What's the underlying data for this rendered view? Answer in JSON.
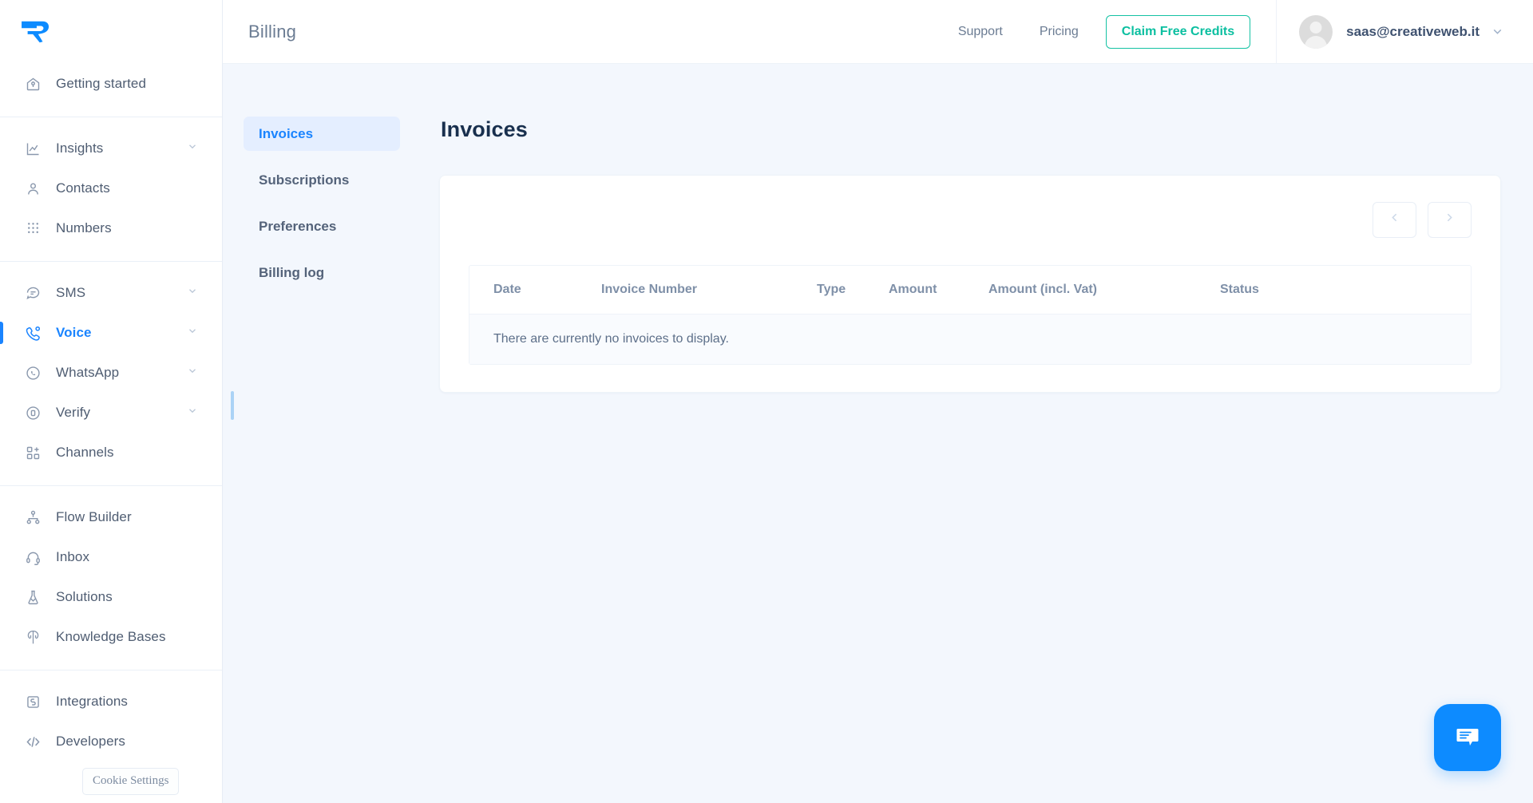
{
  "brand": {
    "logo_name": "messagebird-logo",
    "accent_blue": "#1a84ff",
    "accent_teal": "#0bbfa0",
    "page_bg": "#f3f7fd"
  },
  "sidebar": {
    "groups": [
      {
        "items": [
          {
            "label": "Getting started",
            "icon": "home-rocket-icon",
            "active": false,
            "expandable": false
          }
        ]
      },
      {
        "items": [
          {
            "label": "Insights",
            "icon": "chart-line-icon",
            "active": false,
            "expandable": true
          },
          {
            "label": "Contacts",
            "icon": "person-icon",
            "active": false,
            "expandable": false
          },
          {
            "label": "Numbers",
            "icon": "dialpad-icon",
            "active": false,
            "expandable": false
          }
        ]
      },
      {
        "items": [
          {
            "label": "SMS",
            "icon": "speech-bubble-icon",
            "active": false,
            "expandable": true
          },
          {
            "label": "Voice",
            "icon": "phone-icon",
            "active": true,
            "expandable": true
          },
          {
            "label": "WhatsApp",
            "icon": "whatsapp-icon",
            "active": false,
            "expandable": true
          },
          {
            "label": "Verify",
            "icon": "verify-shield-icon",
            "active": false,
            "expandable": true
          },
          {
            "label": "Channels",
            "icon": "channels-grid-icon",
            "active": false,
            "expandable": false
          }
        ]
      },
      {
        "items": [
          {
            "label": "Flow Builder",
            "icon": "flow-nodes-icon",
            "active": false,
            "expandable": false
          },
          {
            "label": "Inbox",
            "icon": "headset-icon",
            "active": false,
            "expandable": false
          },
          {
            "label": "Solutions",
            "icon": "flask-icon",
            "active": false,
            "expandable": false
          },
          {
            "label": "Knowledge Bases",
            "icon": "knowledge-tree-icon",
            "active": false,
            "expandable": false
          }
        ]
      },
      {
        "items": [
          {
            "label": "Integrations",
            "icon": "integrations-icon",
            "active": false,
            "expandable": false
          },
          {
            "label": "Developers",
            "icon": "code-brackets-icon",
            "active": false,
            "expandable": false
          }
        ]
      }
    ],
    "cookie_settings_label": "Cookie Settings"
  },
  "topbar": {
    "page_title": "Billing",
    "support_label": "Support",
    "pricing_label": "Pricing",
    "claim_credits_label": "Claim Free Credits",
    "user_email": "saas@creativeweb.it",
    "user_chevron_icon": "chevron-down-icon",
    "avatar_icon": "avatar-placeholder"
  },
  "subnav": {
    "items": [
      {
        "label": "Invoices",
        "active": true
      },
      {
        "label": "Subscriptions",
        "active": false
      },
      {
        "label": "Preferences",
        "active": false
      },
      {
        "label": "Billing log",
        "active": false
      }
    ]
  },
  "invoices_panel": {
    "title": "Invoices",
    "pagination": {
      "prev_icon": "chevron-left-icon",
      "next_icon": "chevron-right-icon",
      "prev_disabled": true,
      "next_disabled": true
    },
    "table": {
      "columns": [
        "Date",
        "Invoice Number",
        "Type",
        "Amount",
        "Amount (incl. Vat)",
        "Status"
      ],
      "rows": [],
      "empty_message": "There are currently no invoices to display."
    }
  },
  "chat_widget": {
    "icon": "chat-bubble-icon",
    "color": "#0d8bff"
  }
}
